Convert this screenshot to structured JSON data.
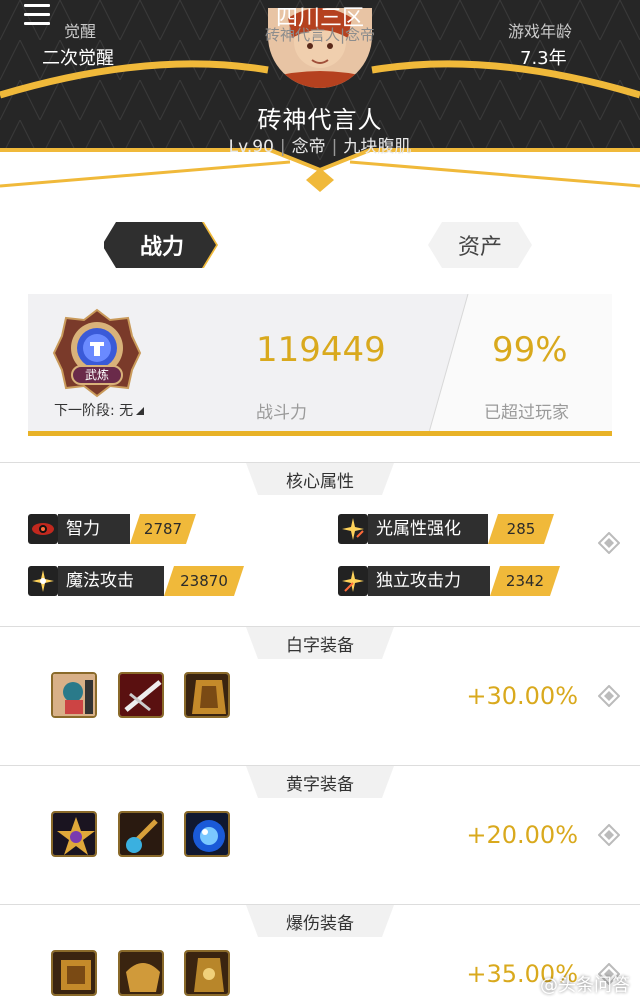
{
  "header": {
    "awaken_label": "觉醒",
    "awaken_value": "二次觉醒",
    "server": "四川三区",
    "server_sub": "砖神代言人|念帝",
    "age_label": "游戏年龄",
    "age_value": "7.3年",
    "char_name": "砖神代言人",
    "level": "Lv.90",
    "class": "念帝",
    "guild": "九块腹肌"
  },
  "tabs": {
    "power": "战力",
    "assets": "资产"
  },
  "power": {
    "badge_text": "武炼",
    "next_stage": "下一阶段: 无",
    "score": "119449",
    "score_label": "战斗力",
    "percent": "99%",
    "percent_label": "已超过玩家"
  },
  "core": {
    "title": "核心属性",
    "attrs": [
      {
        "name": "智力",
        "value": "2787",
        "icon": "eye-icon"
      },
      {
        "name": "光属性强化",
        "value": "285",
        "icon": "sparkle-sword-icon"
      },
      {
        "name": "魔法攻击",
        "value": "23870",
        "icon": "sparkle-icon"
      },
      {
        "name": "独立攻击力",
        "value": "2342",
        "icon": "sword-sparkle-icon"
      }
    ]
  },
  "white_equip": {
    "title": "白字装备",
    "bonus": "+30.00%"
  },
  "yellow_equip": {
    "title": "黄字装备",
    "bonus": "+20.00%"
  },
  "crit_equip": {
    "title": "爆伤装备",
    "bonus": "+35.00%"
  },
  "watermark": "@头条问答",
  "colors": {
    "gold": "#d9a91d",
    "dark": "#2f2f2f",
    "accent": "#f0b93a"
  }
}
